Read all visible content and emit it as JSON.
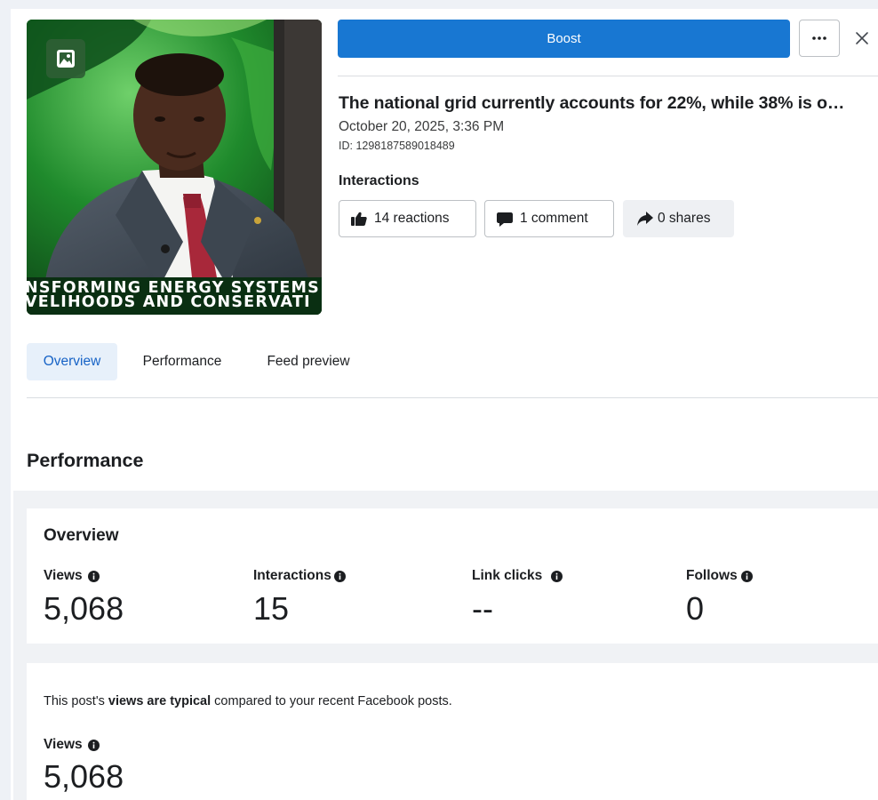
{
  "thumbnail": {
    "ticker_line1": "NSFORMING ENERGY SYSTEMS",
    "ticker_line2": "VELIHOODS AND CONSERVATI",
    "badge_icon": "image-icon"
  },
  "header": {
    "boost_label": "Boost",
    "more_icon": "more-icon",
    "close_icon": "close-icon"
  },
  "post": {
    "title": "The national grid currently accounts for 22%, while 38% is o…",
    "date": "October 20, 2025, 3:36 PM",
    "id": "ID: 1298187589018489"
  },
  "interactions": {
    "label": "Interactions",
    "reactions": "14 reactions",
    "comments": "1 comment",
    "shares": "0 shares"
  },
  "tabs": [
    {
      "label": "Overview",
      "active": true
    },
    {
      "label": "Performance",
      "active": false
    },
    {
      "label": "Feed preview",
      "active": false
    }
  ],
  "performance": {
    "title": "Performance",
    "overview": {
      "title": "Overview",
      "metrics": [
        {
          "label": "Views",
          "value": "5,068"
        },
        {
          "label": "Interactions",
          "value": "15"
        },
        {
          "label": "Link clicks",
          "value": "--"
        },
        {
          "label": "Follows",
          "value": "0"
        }
      ]
    },
    "views_card": {
      "text_prefix": "This post's ",
      "text_bold": "views are typical",
      "text_suffix": " compared to your recent Facebook posts.",
      "label": "Views",
      "value": "5,068"
    }
  },
  "colors": {
    "accent": "#1877d2",
    "tab_active_bg": "#e7f0fa",
    "tab_active_text": "#1763c6",
    "page_bg": "#f0f2f5"
  }
}
